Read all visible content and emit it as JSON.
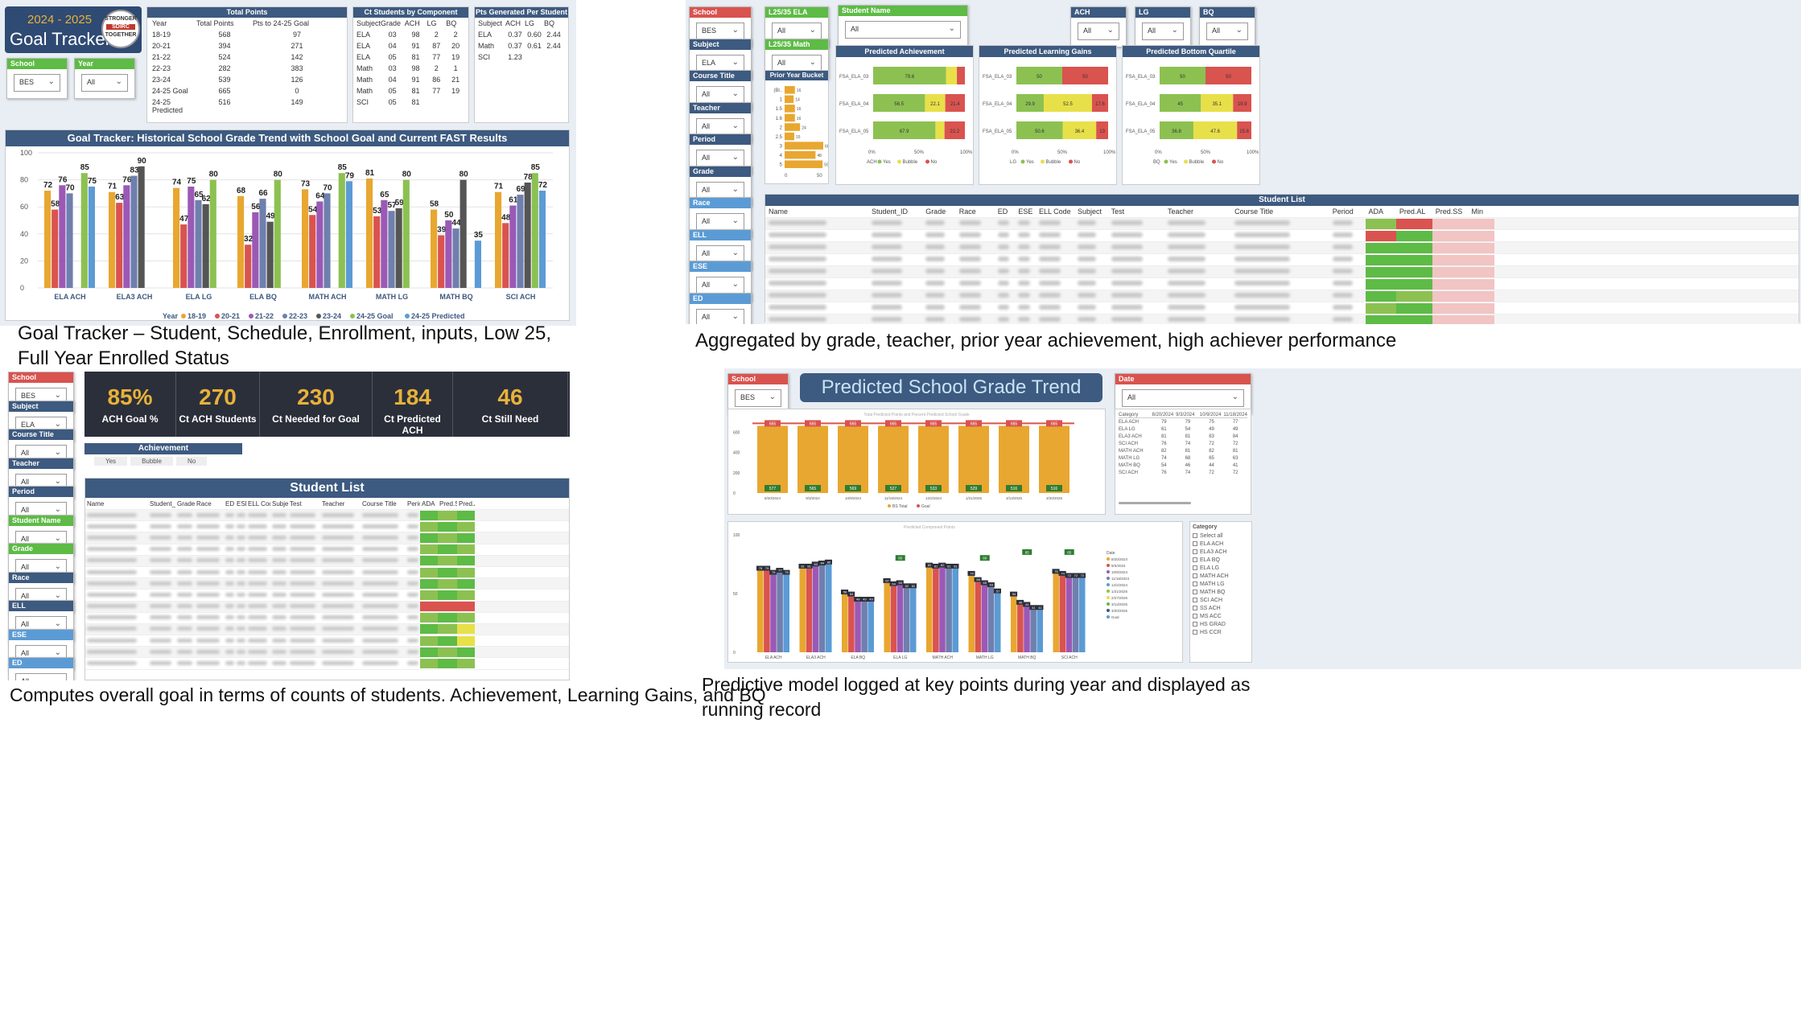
{
  "q1": {
    "logo": {
      "year": "2024 - 2025",
      "title": "Goal Tracker",
      "seal": [
        "STRONGER",
        "SDIRC",
        "TOGETHER"
      ]
    },
    "slicers": [
      {
        "label": "School",
        "value": "BES",
        "color": "#5dbb46"
      },
      {
        "label": "Year",
        "value": "All",
        "color": "#5dbb46"
      }
    ],
    "total_points": {
      "title": "Total Points",
      "cols": [
        "Year",
        "Total Points",
        "Pts to 24-25 Goal"
      ],
      "rows": [
        [
          "18-19",
          "568",
          "97"
        ],
        [
          "20-21",
          "394",
          "271"
        ],
        [
          "21-22",
          "524",
          "142"
        ],
        [
          "22-23",
          "282",
          "383"
        ],
        [
          "23-24",
          "539",
          "126"
        ],
        [
          "24-25 Goal",
          "665",
          "0"
        ],
        [
          "24-25 Predicted",
          "516",
          "149"
        ]
      ]
    },
    "ct_students": {
      "title": "Ct Students by Component",
      "cols": [
        "Subject",
        "Grade",
        "ACH",
        "LG",
        "BQ"
      ],
      "rows": [
        [
          "ELA",
          "03",
          "98",
          "2",
          "2"
        ],
        [
          "ELA",
          "04",
          "91",
          "87",
          "20"
        ],
        [
          "ELA",
          "05",
          "81",
          "77",
          "19"
        ],
        [
          "Math",
          "03",
          "98",
          "2",
          "1"
        ],
        [
          "Math",
          "04",
          "91",
          "86",
          "21"
        ],
        [
          "Math",
          "05",
          "81",
          "77",
          "19"
        ],
        [
          "SCI",
          "05",
          "81",
          "",
          ""
        ]
      ]
    },
    "pts_per_student": {
      "title": "Pts Generated Per Student",
      "cols": [
        "Subject",
        "ACH",
        "LG",
        "BQ"
      ],
      "rows": [
        [
          "ELA",
          "0.37",
          "0.60",
          "2.44"
        ],
        [
          "Math",
          "0.37",
          "0.61",
          "2.44"
        ],
        [
          "SCI",
          "1.23",
          "",
          ""
        ]
      ]
    },
    "chart_title": "Goal Tracker: Historical School Grade Trend with School Goal and Current FAST Results",
    "caption": "Goal Tracker – Student, Schedule, Enrollment, inputs, Low 25, Full Year Enrolled Status"
  },
  "chart_data": [
    {
      "type": "bar",
      "title": "Goal Tracker: Historical School Grade Trend with School Goal and Current FAST Results",
      "categories": [
        "ELA ACH",
        "ELA3 ACH",
        "ELA LG",
        "ELA BQ",
        "MATH ACH",
        "MATH LG",
        "MATH BQ",
        "SCI ACH"
      ],
      "legend_title": "Year",
      "ylim": [
        0,
        100
      ],
      "yticks": [
        0,
        20,
        40,
        60,
        80,
        100
      ],
      "series": [
        {
          "name": "18-19",
          "color": "#e8a730",
          "values": [
            72,
            71,
            74,
            68,
            73,
            81,
            58,
            71
          ]
        },
        {
          "name": "20-21",
          "color": "#d9534f",
          "values": [
            58,
            63,
            47,
            32,
            54,
            53,
            39,
            48
          ]
        },
        {
          "name": "21-22",
          "color": "#9b59b6",
          "values": [
            76,
            76,
            75,
            56,
            64,
            65,
            50,
            61
          ]
        },
        {
          "name": "22-23",
          "color": "#6f7fae",
          "values": [
            70,
            83,
            65,
            66,
            70,
            57,
            44,
            69
          ]
        },
        {
          "name": "23-24",
          "color": "#555555",
          "values": [
            null,
            90,
            62,
            49,
            null,
            59,
            80,
            78
          ]
        },
        {
          "name": "24-25 Goal",
          "color": "#8cc152",
          "values": [
            85,
            null,
            80,
            80,
            85,
            80,
            null,
            85
          ]
        },
        {
          "name": "24-25 Predicted",
          "color": "#5b9bd5",
          "values": [
            75,
            null,
            null,
            null,
            79,
            null,
            35,
            72
          ]
        }
      ]
    },
    {
      "type": "bar",
      "categories": [
        "FSA_ELA_03",
        "FSA_ELA_04",
        "FSA_ELA_05"
      ],
      "title": "Predicted Achievement",
      "series": [
        {
          "name": "Yes",
          "color": "#8cc152",
          "values": [
            79.6,
            56.5,
            67.9
          ]
        },
        {
          "name": "Bubble",
          "color": "#e8e049",
          "values": [
            11.7,
            22.1,
            9.9
          ]
        },
        {
          "name": "No",
          "color": "#d9534f",
          "values": [
            8.7,
            21.4,
            22.2
          ]
        }
      ],
      "legend_title": "ACH"
    },
    {
      "type": "bar",
      "categories": [
        "FSA_ELA_03",
        "FSA_ELA_04",
        "FSA_ELA_05"
      ],
      "title": "Predicted Learning Gains",
      "series": [
        {
          "name": "Yes",
          "color": "#8cc152",
          "values": [
            50.0,
            29.9,
            50.6
          ]
        },
        {
          "name": "Bubble",
          "color": "#e8e049",
          "values": [
            0,
            52.5,
            36.4
          ]
        },
        {
          "name": "No",
          "color": "#d9534f",
          "values": [
            50.0,
            17.6,
            13.0
          ]
        }
      ],
      "legend_title": "LG"
    },
    {
      "type": "bar",
      "categories": [
        "FSA_ELA_03",
        "FSA_ELA_04",
        "FSA_ELA_05"
      ],
      "title": "Predicted Bottom Quartile",
      "series": [
        {
          "name": "Yes",
          "color": "#8cc152",
          "values": [
            50.0,
            45.0,
            36.8
          ]
        },
        {
          "name": "Bubble",
          "color": "#e8e049",
          "values": [
            0,
            35.1,
            47.6
          ]
        },
        {
          "name": "No",
          "color": "#d9534f",
          "values": [
            50.0,
            19.9,
            15.6
          ]
        }
      ],
      "legend_title": "BQ"
    },
    {
      "type": "bar",
      "title": "Prior Year Bucket",
      "categories": [
        "(Bl..",
        "1",
        "1.5",
        "1.6",
        "2",
        "2.5",
        "3",
        "4",
        "5"
      ],
      "values": [
        16,
        14,
        16,
        16,
        24,
        15,
        60,
        48,
        59
      ],
      "xticks": [
        "0",
        "50"
      ]
    },
    {
      "type": "bar",
      "title": "Total Predicted Points and Percent Predicted School Grade",
      "categories": [
        "8/20/2024",
        "9/3/2024",
        "10/9/2024",
        "11/18/2024",
        "12/2/2024",
        "1/21/2025",
        "3/13/2025",
        "3/20/2025"
      ],
      "series": [
        {
          "name": "BS Total",
          "color": "#e8a730",
          "values": [
            577,
            565,
            569,
            527,
            533,
            529,
            516,
            516
          ]
        },
        {
          "name": "Goal",
          "color": "#d9534f",
          "values": [
            665,
            665,
            665,
            665,
            665,
            665,
            665,
            665
          ]
        }
      ]
    },
    {
      "type": "bar",
      "title": "Predicted Component Points",
      "categories": [
        "ELA ACH",
        "ELA3 ACH",
        "ELA BQ",
        "ELA LG",
        "MATH ACH",
        "MATH LG",
        "MATH BQ",
        "SCI ACH"
      ],
      "goal": [
        null,
        null,
        null,
        80,
        null,
        80,
        85,
        85
      ],
      "series": [
        {
          "name": "8/20/2024",
          "color": "#e8a730",
          "values": [
            79,
            81,
            56,
            67,
            82,
            74,
            54,
            76
          ]
        },
        {
          "name": "9/3/2024",
          "color": "#d9534f",
          "values": [
            79,
            81,
            54,
            64,
            81,
            68,
            46,
            74
          ]
        },
        {
          "name": "10/9/2024",
          "color": "#9b59b6",
          "values": [
            75,
            83,
            49,
            65,
            82,
            65,
            44,
            72
          ]
        },
        {
          "name": "11/18/2024",
          "color": "#6f7fae",
          "values": [
            77,
            84,
            49,
            62,
            81,
            63,
            41,
            72
          ]
        },
        {
          "name": "12/2/2024",
          "color": "#5b9bd5",
          "values": [
            75,
            85,
            49,
            62,
            81,
            57,
            41,
            72
          ]
        }
      ]
    }
  ],
  "q2": {
    "slicers_left": [
      {
        "label": "School",
        "value": "BES",
        "color": "#d9534f"
      },
      {
        "label": "Subject",
        "value": "ELA",
        "color": "#3d5a80"
      },
      {
        "label": "Course Title",
        "value": "All",
        "color": "#3d5a80"
      },
      {
        "label": "Teacher",
        "value": "All",
        "color": "#3d5a80"
      },
      {
        "label": "Period",
        "value": "All",
        "color": "#3d5a80"
      },
      {
        "label": "Grade",
        "value": "All",
        "color": "#3d5a80"
      },
      {
        "label": "Race",
        "value": "All",
        "color": "#5b9bd5"
      },
      {
        "label": "ELL",
        "value": "All",
        "color": "#5b9bd5"
      },
      {
        "label": "ESE",
        "value": "All",
        "color": "#5b9bd5"
      },
      {
        "label": "ED",
        "value": "All",
        "color": "#5b9bd5"
      }
    ],
    "slicers_mid": [
      {
        "label": "L25/35 ELA",
        "value": "All",
        "color": "#5dbb46"
      },
      {
        "label": "L25/35 Math",
        "value": "All",
        "color": "#5dbb46"
      }
    ],
    "student_name": {
      "label": "Student Name",
      "value": "All"
    },
    "top_slicers": [
      {
        "label": "ACH",
        "value": "All"
      },
      {
        "label": "LG",
        "value": "All"
      },
      {
        "label": "BQ",
        "value": "All"
      }
    ],
    "prior_year_title": "Prior Year Bucket",
    "student_list_title": "Student List",
    "cols": [
      "Name",
      "Student_ID",
      "Grade",
      "Race",
      "ED",
      "ESE",
      "ELL Code",
      "Subject",
      "Test",
      "Teacher",
      "Course Title",
      "Period",
      "ADA",
      "Pred.AL",
      "Pred.SS",
      "Min"
    ],
    "legend_yes": "Yes",
    "legend_bubble": "Bubble",
    "legend_no": "No",
    "axis": [
      "0%",
      "50%",
      "100%"
    ],
    "caption": "Aggregated by grade, teacher, prior year achievement, high achiever performance"
  },
  "q3": {
    "slicers": [
      {
        "label": "School",
        "value": "BES",
        "color": "#d9534f"
      },
      {
        "label": "Subject",
        "value": "ELA",
        "color": "#3d5a80"
      },
      {
        "label": "Course Title",
        "value": "All",
        "color": "#3d5a80"
      },
      {
        "label": "Teacher",
        "value": "All",
        "color": "#3d5a80"
      },
      {
        "label": "Period",
        "value": "All",
        "color": "#3d5a80"
      },
      {
        "label": "Student Name",
        "value": "All",
        "color": "#5dbb46"
      },
      {
        "label": "Grade",
        "value": "All",
        "color": "#5dbb46"
      },
      {
        "label": "Race",
        "value": "All",
        "color": "#3d5a80"
      },
      {
        "label": "ELL",
        "value": "All",
        "color": "#3d5a80"
      },
      {
        "label": "ESE",
        "value": "All",
        "color": "#5b9bd5"
      },
      {
        "label": "ED",
        "value": "All",
        "color": "#5b9bd5"
      }
    ],
    "kpis": [
      {
        "value": "85%",
        "label": "ACH Goal %"
      },
      {
        "value": "270",
        "label": "Ct ACH Students"
      },
      {
        "value": "230",
        "label": "Ct Needed for Goal"
      },
      {
        "value": "184",
        "label": "Ct Predicted ACH"
      },
      {
        "value": "46",
        "label": "Ct Still Need"
      }
    ],
    "achievement": {
      "title": "Achievement",
      "options": [
        "Yes",
        "Bubble",
        "No"
      ]
    },
    "student_list_title": "Student List",
    "cols": [
      "Name",
      "Student_ID",
      "Grade",
      "Race",
      "ED",
      "ESE",
      "ELL Code",
      "Subject",
      "Test",
      "Teacher",
      "Course Title",
      "Period",
      "ADA",
      "Pred.SS",
      "Pred.AL"
    ],
    "caption": "Computes overall goal in terms of counts of students. Achievement, Learning Gains, and BQ"
  },
  "q4": {
    "school": {
      "label": "School",
      "value": "BES"
    },
    "title": "Predicted School Grade Trend Data",
    "date": {
      "label": "Date",
      "value": "All"
    },
    "matrix": {
      "cols": [
        "Category",
        "8/20/2024",
        "9/3/2024",
        "10/9/2024",
        "11/18/2024"
      ],
      "rows": [
        [
          "ELA ACH",
          "79",
          "79",
          "75",
          "77"
        ],
        [
          "ELA LG",
          "61",
          "54",
          "49",
          "49"
        ],
        [
          "ELA3 ACH",
          "81",
          "81",
          "83",
          "84"
        ],
        [
          "SCI ACH",
          "76",
          "74",
          "72",
          "72"
        ],
        [
          "MATH ACH",
          "82",
          "81",
          "82",
          "81"
        ],
        [
          "MATH LG",
          "74",
          "68",
          "65",
          "63"
        ],
        [
          "MATH BQ",
          "54",
          "46",
          "44",
          "41"
        ],
        [
          "SCI ACH",
          "76",
          "74",
          "72",
          "72"
        ]
      ]
    },
    "category_list": [
      "Select all",
      "ELA ACH",
      "ELA3 ACH",
      "ELA BQ",
      "ELA LG",
      "MATH ACH",
      "MATH LG",
      "MATH BQ",
      "SCI ACH",
      "SS ACH",
      "MS ACC",
      "HS GRAD",
      "HS CCR"
    ],
    "category_title": "Category",
    "date_legend_title": "Date",
    "date_legend": [
      "8/20/2024",
      "9/3/2024",
      "10/9/2024",
      "11/18/2024",
      "12/2/2024",
      "1/21/2025",
      "2/27/2025",
      "3/13/2025",
      "3/20/2025",
      "Goal"
    ],
    "caption": "Predictive model logged at key points during year and displayed as running record"
  }
}
